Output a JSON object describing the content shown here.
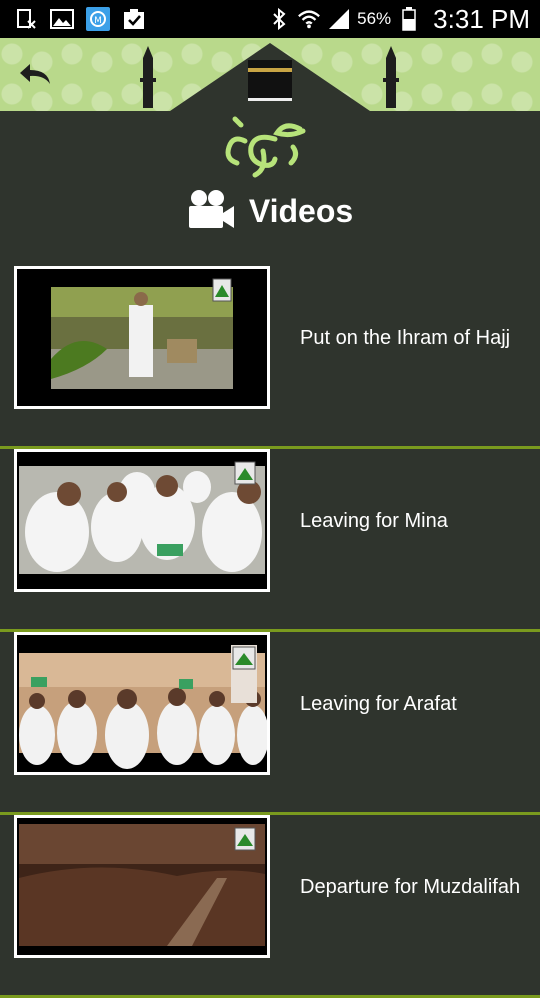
{
  "status_bar": {
    "battery": "56%",
    "time": "3:31 PM"
  },
  "header": {
    "back_icon": "back-arrow-icon",
    "center_icon": "kaaba-icon"
  },
  "page": {
    "title": "Videos",
    "title_icon": "video-camera-icon"
  },
  "videos": [
    {
      "title": "Put on the Ihram of Hajj"
    },
    {
      "title": "Leaving for Mina"
    },
    {
      "title": "Leaving for Arafat"
    },
    {
      "title": "Departure for Muzdalifah"
    }
  ],
  "colors": {
    "background": "#2f342d",
    "header": "#b9d98b",
    "divider": "#7a9a1e",
    "logo": "#b7e37a"
  }
}
